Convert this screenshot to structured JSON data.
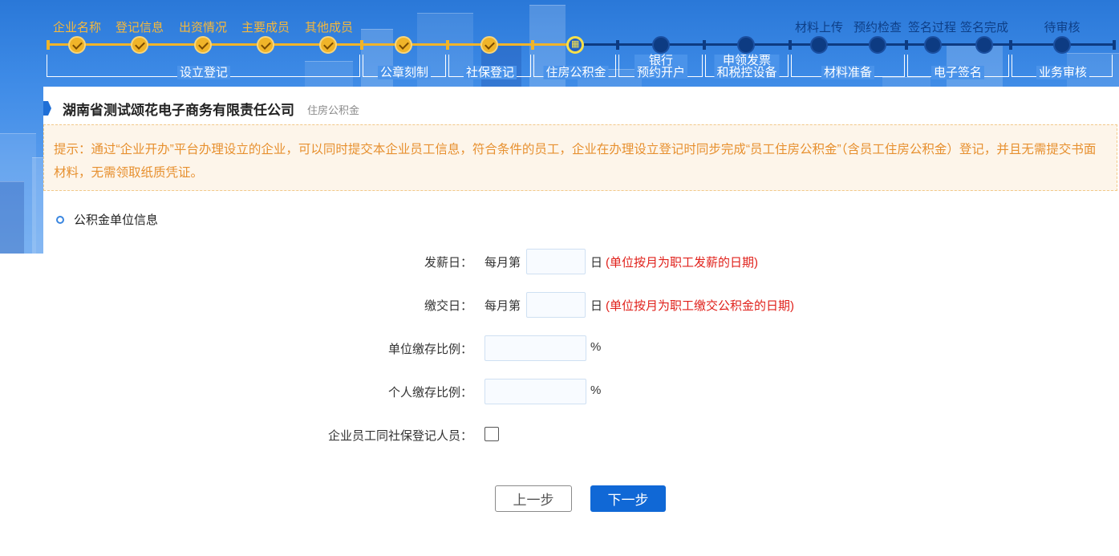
{
  "progress": {
    "top_labels": [
      "企业名称",
      "登记信息",
      "出资情况",
      "主要成员",
      "其他成员",
      "材料上传",
      "预约检查",
      "签名过程",
      "签名完成",
      "待审核"
    ],
    "groups": [
      {
        "label": "设立登记"
      },
      {
        "label": "公章刻制"
      },
      {
        "label": "社保登记"
      },
      {
        "label": "住房公积金"
      },
      {
        "label_line1": "银行",
        "label_line2": "预约开户"
      },
      {
        "label_line1": "申领发票",
        "label_line2": "和税控设备"
      },
      {
        "label": "材料准备"
      },
      {
        "label": "电子签名"
      },
      {
        "label": "业务审核"
      }
    ],
    "colors": {
      "done": "#f0b429",
      "current": "#f7e04a",
      "todo": "#0d3b82"
    }
  },
  "company": {
    "name": "湖南省测试颂花电子商务有限责任公司",
    "subtitle": "住房公积金"
  },
  "notice": {
    "text": "提示：通过“企业开办”平台办理设立的企业，可以同时提交本企业员工信息，符合条件的员工，企业在办理设立登记时同步完成“员工住房公积金”（含员工住房公积金）登记，并且无需提交书面材料，无需领取纸质凭证。"
  },
  "section": {
    "title": "公积金单位信息"
  },
  "form": {
    "pay_day": {
      "label": "发薪日：",
      "prefix": "每月第",
      "value": "",
      "suffix": "日",
      "hint": "(单位按月为职工发薪的日期)"
    },
    "contribution_day": {
      "label": "缴交日：",
      "prefix": "每月第",
      "value": "",
      "suffix": "日",
      "hint": "(单位按月为职工缴交公积金的日期)"
    },
    "unit_ratio": {
      "label": "单位缴存比例：",
      "value": "",
      "suffix": "%"
    },
    "personal_ratio": {
      "label": "个人缴存比例：",
      "value": "",
      "suffix": "%"
    },
    "same_as_social": {
      "label": "企业员工同社保登记人员：",
      "checked": false
    }
  },
  "buttons": {
    "prev": "上一步",
    "next": "下一步"
  }
}
